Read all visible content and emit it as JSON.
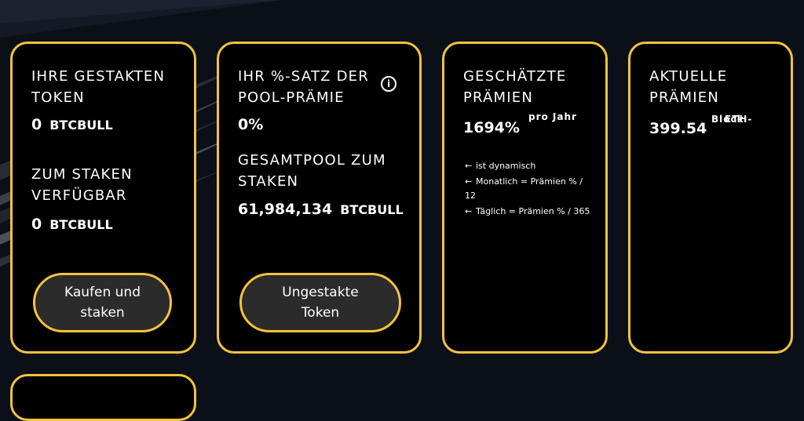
{
  "cards": {
    "staked": {
      "title": "IHRE GESTAKTEN TOKEN",
      "amount": "0",
      "unit": "BTCBULL",
      "available_title": "ZUM STAKEN VERFÜGBAR",
      "available_amount": "0",
      "available_unit": "BTCBULL",
      "button_label": "Kaufen und staken"
    },
    "pool": {
      "title": "IHR %-SATZ DER POOL-PRÄMIE",
      "info_glyph": "i",
      "percent": "0%",
      "total_title": "GESAMTPOOL ZUM STAKEN",
      "total_amount": "61,984,134",
      "total_unit": "BTCBULL",
      "button_label": "Ungestakte Token"
    },
    "estimated": {
      "title": "GESCHÄTZTE PRÄMIEN",
      "percent": "1694%",
      "per_year": "pro Jahr",
      "notes": [
        "ist dynamisch",
        "Monatlich = Prämien % / 12",
        "Täglich = Prämien % / 365"
      ],
      "arrow": "←"
    },
    "current": {
      "title": "AKTUELLE PRÄMIEN",
      "amount": "399.54",
      "unit_overlap_a": "Block",
      "unit_overlap_b": "ETH-"
    }
  },
  "colors": {
    "accent": "#f4c33d",
    "background": "#0b0f18",
    "card": "#000000",
    "button": "#2b2b2b"
  }
}
